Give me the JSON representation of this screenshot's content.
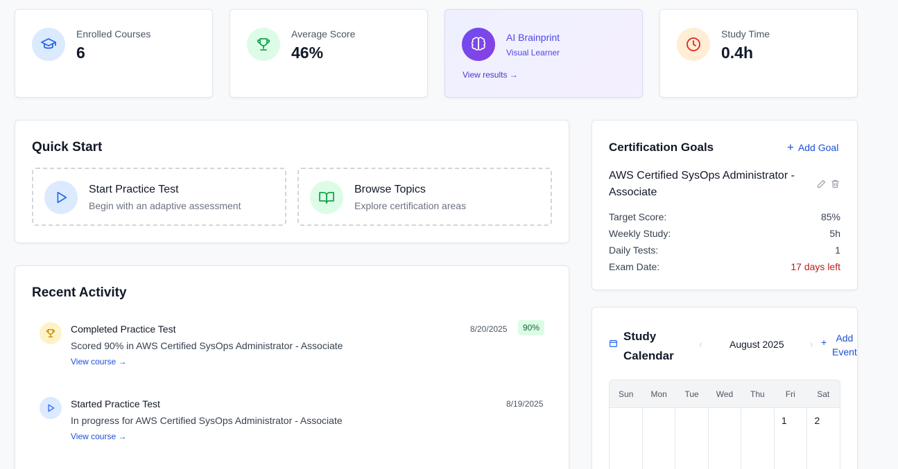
{
  "stats": [
    {
      "label": "Enrolled Courses",
      "value": "6",
      "icon": "graduation-cap-icon"
    },
    {
      "label": "Average Score",
      "value": "46%",
      "icon": "trophy-icon"
    },
    {
      "label": "Study Time",
      "value": "0.4h",
      "icon": "clock-icon"
    }
  ],
  "brainprint": {
    "title": "AI Brainprint",
    "subtitle": "Visual Learner",
    "link": "View results →",
    "icon": "brain-icon"
  },
  "quick_start": {
    "title": "Quick Start",
    "tiles": [
      {
        "title": "Start Practice Test",
        "subtitle": "Begin with an adaptive assessment",
        "icon": "play-icon"
      },
      {
        "title": "Browse Topics",
        "subtitle": "Explore certification areas",
        "icon": "book-open-icon"
      }
    ]
  },
  "recent_activity": {
    "title": "Recent Activity",
    "items": [
      {
        "title": "Completed Practice Test",
        "description": "Scored 90% in AWS Certified SysOps Administrator - Associate",
        "link": "View course →",
        "date": "8/20/2025",
        "badge": "90%",
        "icon": "trophy-icon"
      },
      {
        "title": "Started Practice Test",
        "description": "In progress for AWS Certified SysOps Administrator - Associate",
        "link": "View course →",
        "date": "8/19/2025",
        "icon": "play-icon"
      }
    ]
  },
  "goals": {
    "title": "Certification Goals",
    "add_label": "Add Goal",
    "goal_name": "AWS Certified SysOps Administrator - Associate",
    "rows": [
      {
        "label": "Target Score:",
        "value": "85%"
      },
      {
        "label": "Weekly Study:",
        "value": "5h"
      },
      {
        "label": "Daily Tests:",
        "value": "1"
      },
      {
        "label": "Exam Date:",
        "value": "17 days left"
      }
    ]
  },
  "calendar": {
    "title_line1": "Study",
    "title_line2": "Calendar",
    "month": "August 2025",
    "add_line1": "Add",
    "add_line2": "Event",
    "weekdays": [
      "Sun",
      "Mon",
      "Tue",
      "Wed",
      "Thu",
      "Fri",
      "Sat"
    ],
    "first_week": [
      "",
      "",
      "",
      "",
      "",
      "1",
      "2"
    ]
  },
  "colors": {
    "accent": "#4f46e5",
    "link": "#1d4ed8",
    "danger": "#b91c1c",
    "success": "#166534"
  }
}
